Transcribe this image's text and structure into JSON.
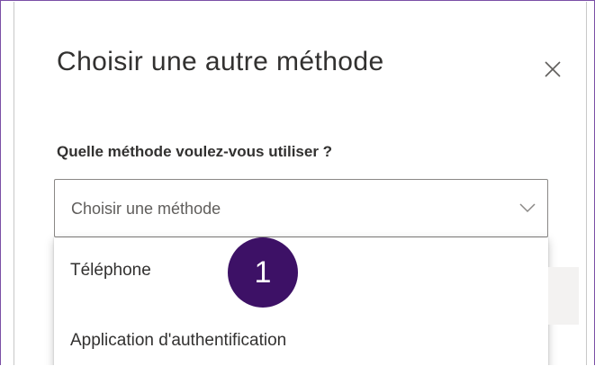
{
  "dialog": {
    "title": "Choisir une autre méthode",
    "close_icon": "close-icon"
  },
  "method_field": {
    "label": "Quelle méthode voulez-vous utiliser ?",
    "placeholder": "Choisir une méthode",
    "chevron_icon": "chevron-down-icon"
  },
  "dropdown": {
    "options": [
      {
        "label": "Téléphone"
      },
      {
        "label": "Application d'authentification"
      }
    ]
  },
  "annotation": {
    "step_number": "1"
  },
  "colors": {
    "frame_border": "#7b4fa6",
    "marker_background": "#3d1166",
    "marker_text": "#ffffff",
    "text_primary": "#323130",
    "text_placeholder": "#605e5c",
    "input_border": "#8a8886"
  }
}
